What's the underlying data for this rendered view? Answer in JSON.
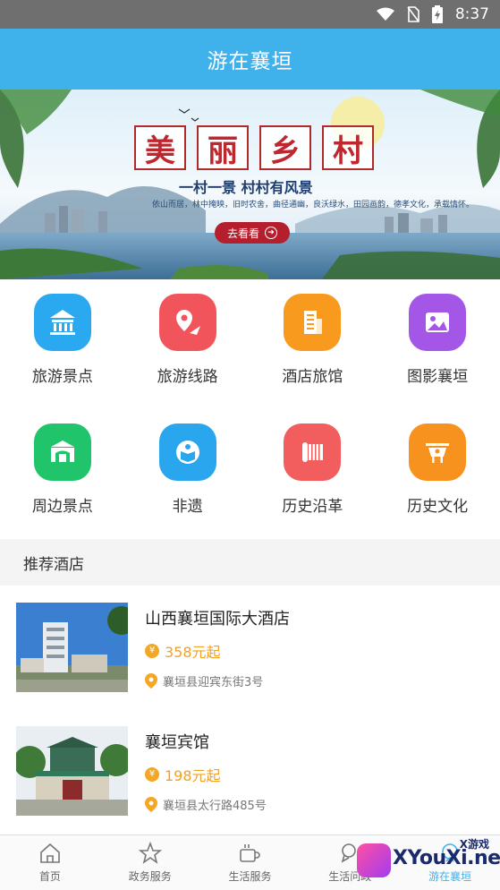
{
  "status": {
    "time": "8:37"
  },
  "header": {
    "title": "游在襄垣"
  },
  "banner": {
    "title_chars": [
      "美",
      "丽",
      "乡",
      "村"
    ],
    "slogan": "一村一景 村村有风景",
    "subtext": "依山而居，林中掩映，旧时农舍，曲径通幽，良沃绿水，田园画韵，德孝文化，承载情怀。",
    "button_label": "去看看"
  },
  "categories": [
    {
      "label": "旅游景点",
      "icon": "temple-icon",
      "color": "#2aa8f0"
    },
    {
      "label": "旅游线路",
      "icon": "route-icon",
      "color": "#f2545b"
    },
    {
      "label": "酒店旅馆",
      "icon": "hotel-icon",
      "color": "#f79a1e"
    },
    {
      "label": "图影襄垣",
      "icon": "gallery-icon",
      "color": "#a457e6"
    },
    {
      "label": "周边景点",
      "icon": "nearby-icon",
      "color": "#1fc46b"
    },
    {
      "label": "非遗",
      "icon": "heritage-book-icon",
      "color": "#29a6ee"
    },
    {
      "label": "历史沿革",
      "icon": "scroll-icon",
      "color": "#f25d5d"
    },
    {
      "label": "历史文化",
      "icon": "bronze-vessel-icon",
      "color": "#f7921e"
    }
  ],
  "recommend": {
    "title": "推荐酒店",
    "hotels": [
      {
        "name": "山西襄垣国际大酒店",
        "price": "358元起",
        "address": "襄垣县迎宾东街3号"
      },
      {
        "name": "襄垣宾馆",
        "price": "198元起",
        "address": "襄垣县太行路485号"
      }
    ]
  },
  "tabbar": {
    "items": [
      {
        "label": "首页",
        "icon": "home-icon"
      },
      {
        "label": "政务服务",
        "icon": "star-icon"
      },
      {
        "label": "生活服务",
        "icon": "coffee-cup-icon"
      },
      {
        "label": "生活问政",
        "icon": "location-chat-icon"
      },
      {
        "label": "游在襄垣",
        "icon": "travel-icon"
      }
    ]
  },
  "watermark": {
    "name": "XYouXi.net",
    "tag": "X游戏"
  },
  "colors": {
    "primary": "#3fb2ec",
    "price": "#f0a126"
  }
}
